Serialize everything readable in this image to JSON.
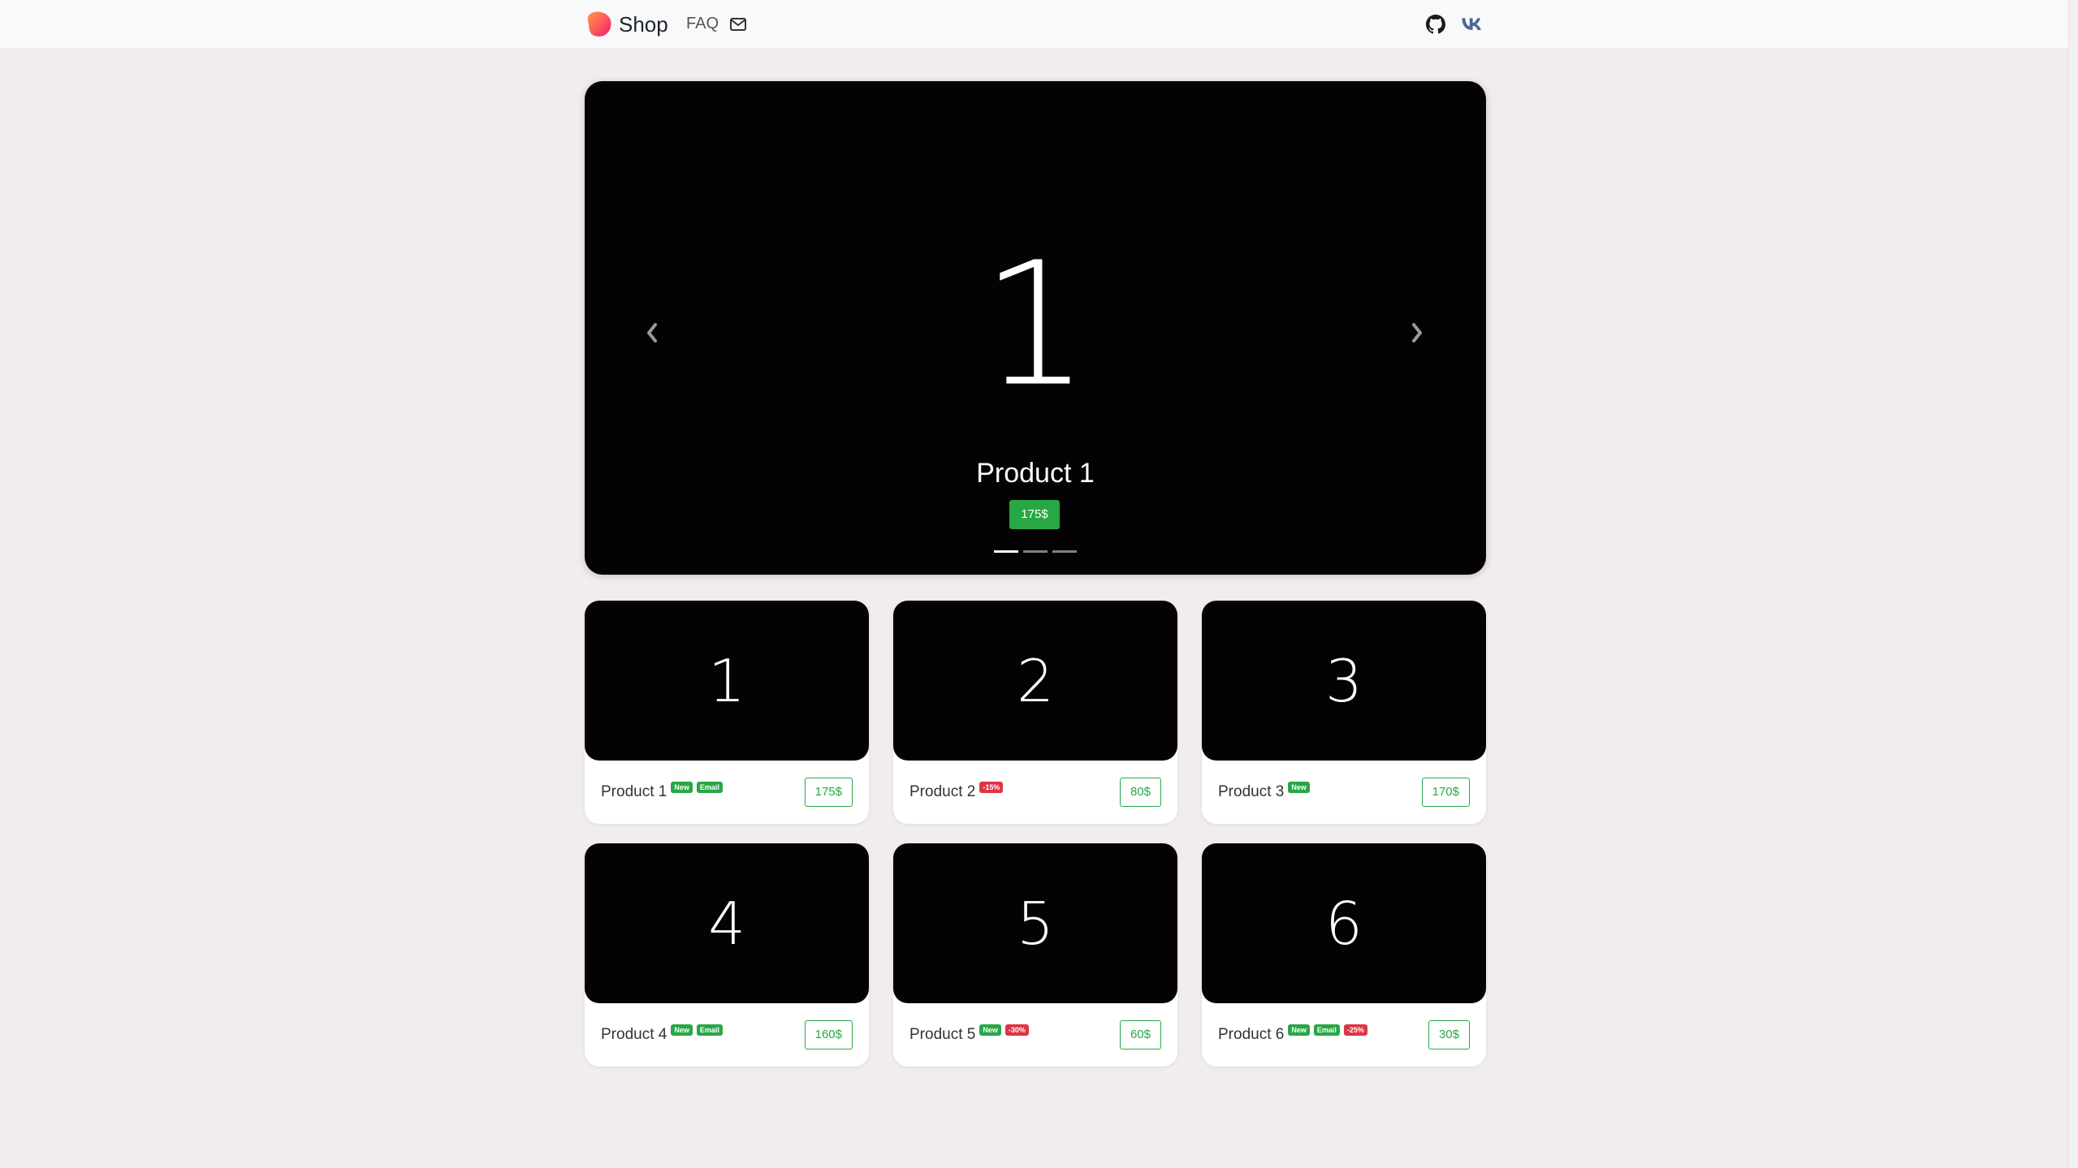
{
  "navbar": {
    "brand": "Shop",
    "faq": "FAQ",
    "icons": {
      "mail": "mail-icon",
      "github": "github-icon",
      "vk": "vk-icon"
    }
  },
  "carousel": {
    "number": "1",
    "title": "Product 1",
    "price": "175$",
    "slides_count": 3,
    "active_slide": 1
  },
  "products": [
    {
      "number": "1",
      "name": "Product 1",
      "badges": [
        {
          "text": "New",
          "color": "green"
        },
        {
          "text": "Email",
          "color": "green"
        }
      ],
      "price": "175$"
    },
    {
      "number": "2",
      "name": "Product 2",
      "badges": [
        {
          "text": "-15%",
          "color": "red"
        }
      ],
      "price": "80$"
    },
    {
      "number": "3",
      "name": "Product 3",
      "badges": [
        {
          "text": "New",
          "color": "green"
        }
      ],
      "price": "170$"
    },
    {
      "number": "4",
      "name": "Product 4",
      "badges": [
        {
          "text": "New",
          "color": "green"
        },
        {
          "text": "Email",
          "color": "green"
        }
      ],
      "price": "160$"
    },
    {
      "number": "5",
      "name": "Product 5",
      "badges": [
        {
          "text": "New",
          "color": "green"
        },
        {
          "text": "-30%",
          "color": "red"
        }
      ],
      "price": "60$"
    },
    {
      "number": "6",
      "name": "Product 6",
      "badges": [
        {
          "text": "New",
          "color": "green"
        },
        {
          "text": "Email",
          "color": "green"
        },
        {
          "text": "-25%",
          "color": "red"
        }
      ],
      "price": "30$"
    }
  ],
  "colors": {
    "success": "#28a745",
    "danger": "#dc3545",
    "background": "#f0ecf0"
  }
}
